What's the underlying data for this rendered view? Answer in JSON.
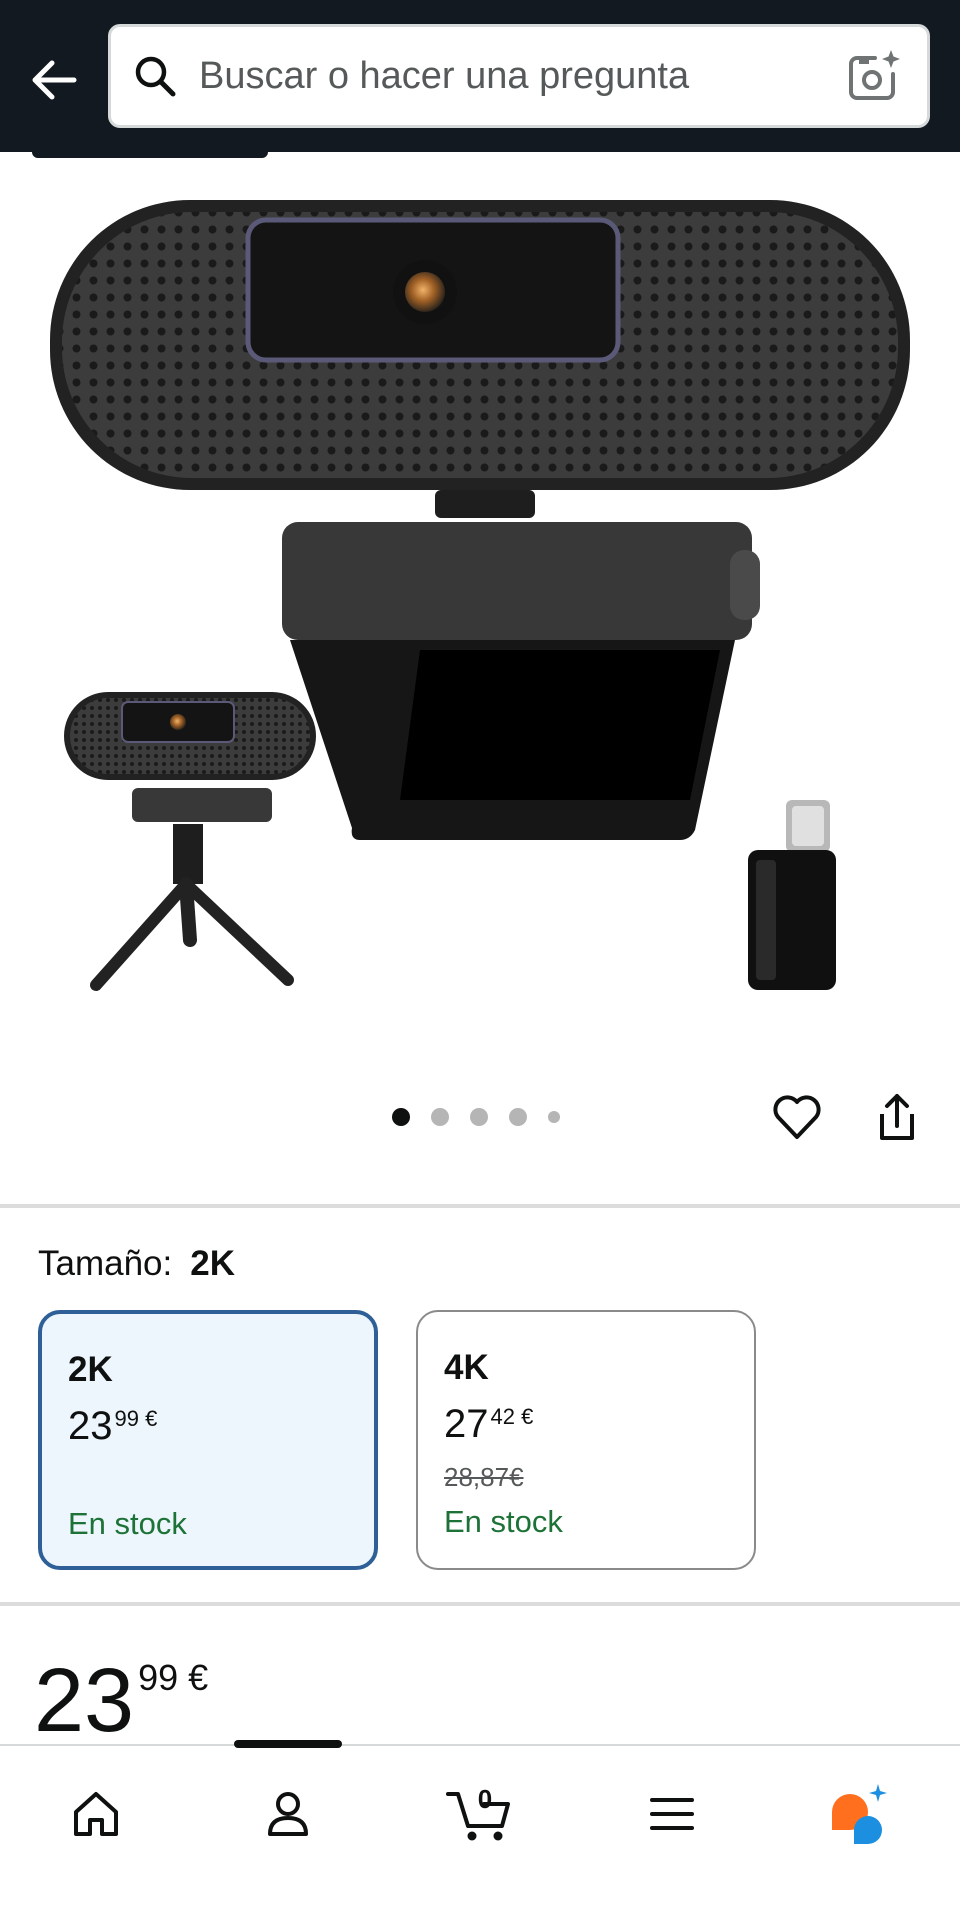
{
  "header": {
    "back_icon": "arrow-left-icon",
    "search_placeholder": "Buscar o hacer una pregunta",
    "search_icon": "search-icon",
    "camera_icon": "camera-ai-icon"
  },
  "product": {
    "image_alt": "Webcam with tripod and USB-C adapter"
  },
  "carousel": {
    "total_images": 5,
    "active_index": 0
  },
  "actions": {
    "favorite_icon": "heart-icon",
    "share_icon": "share-icon"
  },
  "size_selector": {
    "label": "Tamaño:",
    "selected_value": "2K",
    "options": [
      {
        "name": "2K",
        "price_whole": "23",
        "price_fraction": "99 €",
        "list_price": "",
        "stock": "En stock",
        "selected": true
      },
      {
        "name": "4K",
        "price_whole": "27",
        "price_fraction": "42 €",
        "list_price": "28,87€",
        "stock": "En stock",
        "selected": false
      }
    ]
  },
  "price": {
    "whole": "23",
    "fraction": "99 €"
  },
  "bottom_nav": {
    "items": [
      {
        "name": "home",
        "icon": "home-icon"
      },
      {
        "name": "account",
        "icon": "person-icon"
      },
      {
        "name": "cart",
        "icon": "cart-icon",
        "count": "0"
      },
      {
        "name": "menu",
        "icon": "hamburger-menu-icon"
      },
      {
        "name": "rufus",
        "icon": "rufus-ai-icon"
      }
    ]
  },
  "colors": {
    "header_bg": "#131921",
    "selected_border": "#2e5f97",
    "selected_bg": "#edf6fc",
    "stock_green": "#1d7237",
    "rufus_orange": "#ff6f1e",
    "rufus_blue": "#1c8fe0"
  }
}
